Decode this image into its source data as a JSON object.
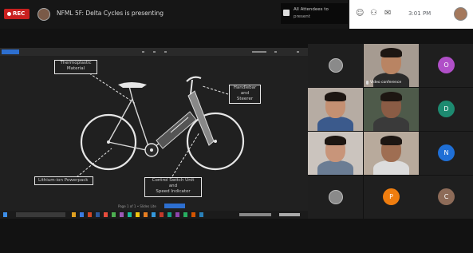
{
  "topbar": {
    "rec_label": "REC",
    "meeting_title": "NFML 5F: Delta Cycles is presenting",
    "notification": {
      "line1": "All Attendees to",
      "line2": "present"
    },
    "clock": "3:01 PM"
  },
  "slide": {
    "callouts": {
      "composite": [
        "Thermoplastic",
        "Material"
      ],
      "handle": [
        "Handlebar",
        "and",
        "Steerer"
      ],
      "battery": "Lithium-ion Powerpack",
      "switch": [
        "Control Switch Unit",
        "and",
        "Speed Indicator"
      ]
    },
    "page_label": "Page 1 of 1  • Slides Lite"
  },
  "participants": [
    {
      "kind": "photo"
    },
    {
      "kind": "video",
      "label": "Video conference",
      "skin": "#b98463",
      "shirt": "#2a2a2a",
      "bg": "#a69b91"
    },
    {
      "kind": "initial",
      "initial": "O",
      "color": "#b04fc8"
    },
    {
      "kind": "video",
      "skin": "#c49072",
      "shirt": "#3b5a8c",
      "bg": "#b6aca3"
    },
    {
      "kind": "video",
      "skin": "#8a5c45",
      "shirt": "#3a3a3a",
      "bg": "#4e5a4a"
    },
    {
      "kind": "initial",
      "initial": "D",
      "color": "#1d8a70"
    },
    {
      "kind": "video",
      "skin": "#c8957a",
      "shirt": "#6b7d94",
      "bg": "#cbc4be"
    },
    {
      "kind": "video",
      "skin": "#9f6e52",
      "shirt": "#dcdcdc",
      "bg": "#b8aa9c"
    },
    {
      "kind": "initial",
      "initial": "N",
      "color": "#1f6fd6"
    },
    {
      "kind": "photo"
    },
    {
      "kind": "initial",
      "initial": "P",
      "color": "#ef7d0f"
    },
    {
      "kind": "initial",
      "initial": "C",
      "color": "#8d6b58"
    }
  ],
  "colors": {
    "rec": "#c9201f",
    "accent": "#2d6fd0"
  }
}
